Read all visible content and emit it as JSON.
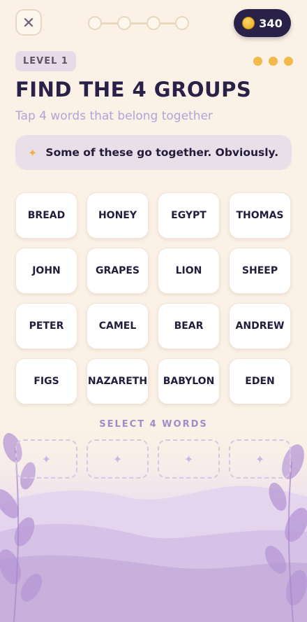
{
  "header": {
    "close_icon": "close-icon",
    "progress_steps": 4,
    "coins": "340",
    "coin_icon": "coin-icon"
  },
  "level": {
    "label": "LEVEL 1",
    "lives_remaining": 3
  },
  "title": "FIND THE 4 GROUPS",
  "subtitle": "Tap 4 words that belong together",
  "hint": {
    "icon": "sparkle-icon",
    "text": "Some of these go together. Obviously."
  },
  "words": [
    "BREAD",
    "HONEY",
    "EGYPT",
    "THOMAS",
    "JOHN",
    "GRAPES",
    "LION",
    "SHEEP",
    "PETER",
    "CAMEL",
    "BEAR",
    "ANDREW",
    "FIGS",
    "NAZARETH",
    "BABYLON",
    "EDEN"
  ],
  "selection": {
    "label": "SELECT 4 WORDS",
    "slot_icon": "sparkle-icon",
    "slots": 4
  },
  "colors": {
    "background": "#fbf1e6",
    "accent_purple": "#b5a2d8",
    "dark": "#2a2148",
    "gold": "#f3b94a"
  }
}
